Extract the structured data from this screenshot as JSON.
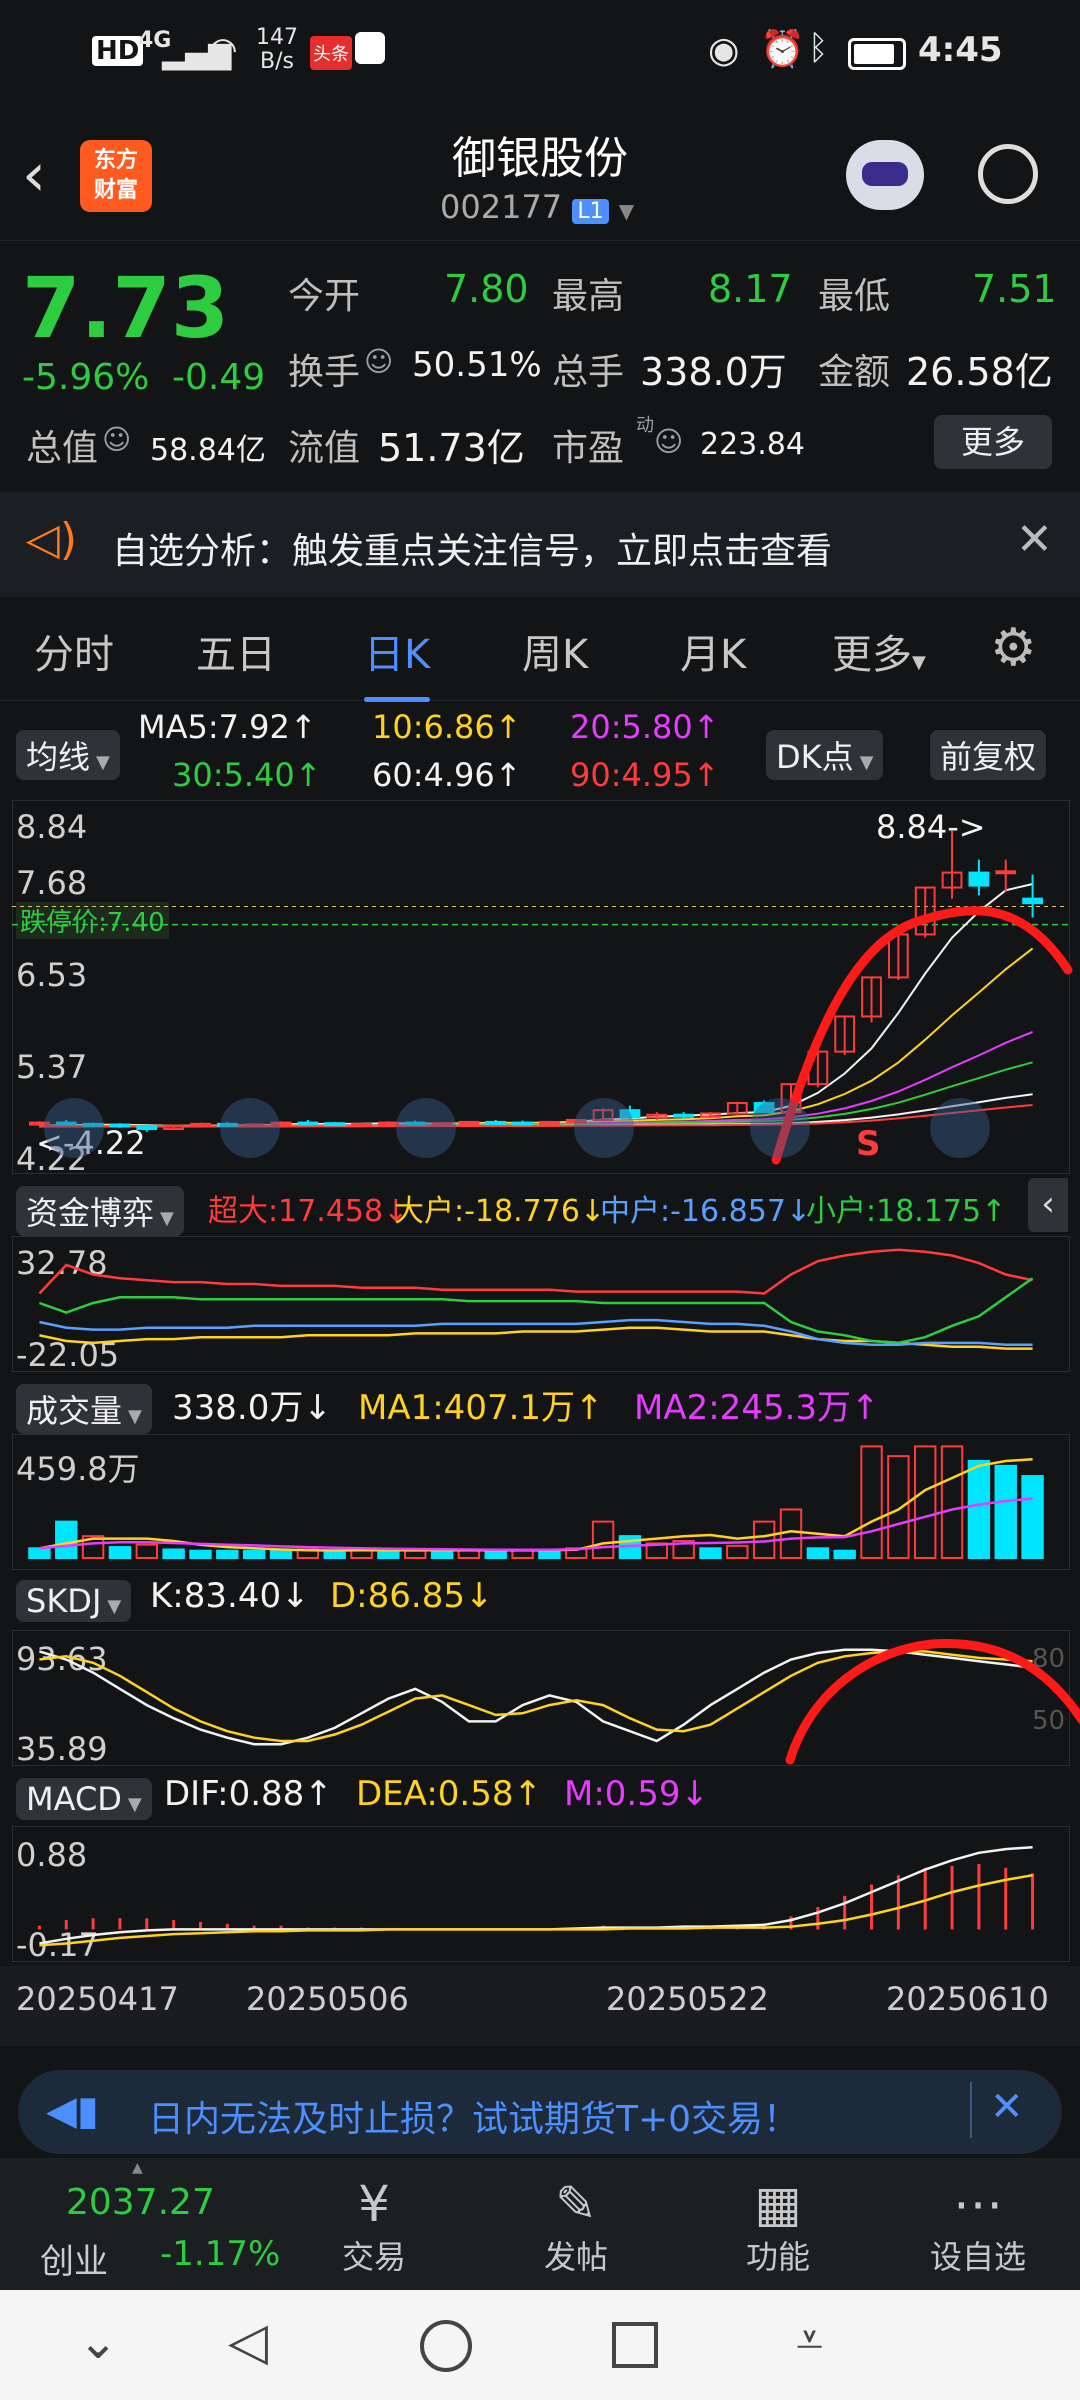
{
  "status_bar": {
    "time": "4:45",
    "network": "4G",
    "speed_value": "147",
    "speed_unit": "B/s",
    "badge": "头条"
  },
  "header": {
    "logo_line1": "东方",
    "logo_line2": "财富",
    "title": "御银股份",
    "code": "002177",
    "market_badge": "L1"
  },
  "quote": {
    "price": "7.73",
    "change_pct": "-5.96%",
    "change": "-0.49",
    "open_label": "今开",
    "open": "7.80",
    "high_label": "最高",
    "high": "8.17",
    "low_label": "最低",
    "low": "7.51",
    "turnover_rate_label": "换手",
    "turnover_rate": "50.51%",
    "volume_label": "总手",
    "volume": "338.0万",
    "amount_label": "金额",
    "amount": "26.58亿",
    "total_cap_label": "总值",
    "total_cap": "58.84亿",
    "float_cap_label": "流值",
    "float_cap": "51.73亿",
    "pe_label": "市盈",
    "pe_superscript": "动",
    "pe": "223.84",
    "more_button": "更多"
  },
  "notice": {
    "text": "自选分析：触发重点关注信号，立即点击查看"
  },
  "tabs": [
    {
      "label": "分时"
    },
    {
      "label": "五日"
    },
    {
      "label": "日K"
    },
    {
      "label": "周K"
    },
    {
      "label": "月K"
    },
    {
      "label": "更多"
    }
  ],
  "chart_data": [
    {
      "type": "candlestick",
      "name": "日K",
      "indicator_selector": "均线",
      "ma_labels": [
        "MA5:7.92↑",
        "10:6.86↑",
        "20:5.80↑",
        "30:5.40↑",
        "60:4.96↑",
        "90:4.95↑"
      ],
      "ma_colors": [
        "#f2f2f2",
        "#ffd21f",
        "#e63cff",
        "#2ecc40",
        "#f2f2f2",
        "#ff3b3b"
      ],
      "buttons": [
        "DK点",
        "前复权"
      ],
      "y_ticks": [
        "8.84",
        "7.68",
        "6.53",
        "5.37",
        "4.22"
      ],
      "ylim": [
        4.0,
        9.1
      ],
      "limit_down_label": "跌停价:7.40",
      "limit_down": 7.4,
      "high_label": "8.84->",
      "low_label": "<-4.22",
      "signal_label": "S",
      "candles": [
        [
          4.35,
          4.38,
          4.32,
          4.36
        ],
        [
          4.36,
          4.4,
          4.33,
          4.34
        ],
        [
          4.34,
          4.36,
          4.3,
          4.33
        ],
        [
          4.33,
          4.35,
          4.28,
          4.3
        ],
        [
          4.3,
          4.32,
          4.22,
          4.26
        ],
        [
          4.26,
          4.33,
          4.25,
          4.31
        ],
        [
          4.31,
          4.36,
          4.29,
          4.34
        ],
        [
          4.34,
          4.37,
          4.3,
          4.32
        ],
        [
          4.32,
          4.35,
          4.29,
          4.33
        ],
        [
          4.33,
          4.38,
          4.31,
          4.36
        ],
        [
          4.36,
          4.4,
          4.33,
          4.35
        ],
        [
          4.35,
          4.37,
          4.31,
          4.33
        ],
        [
          4.33,
          4.36,
          4.3,
          4.34
        ],
        [
          4.34,
          4.38,
          4.32,
          4.36
        ],
        [
          4.36,
          4.39,
          4.33,
          4.34
        ],
        [
          4.34,
          4.37,
          4.31,
          4.35
        ],
        [
          4.35,
          4.38,
          4.32,
          4.37
        ],
        [
          4.37,
          4.4,
          4.34,
          4.36
        ],
        [
          4.36,
          4.39,
          4.33,
          4.35
        ],
        [
          4.35,
          4.38,
          4.32,
          4.37
        ],
        [
          4.37,
          4.42,
          4.35,
          4.4
        ],
        [
          4.4,
          4.58,
          4.38,
          4.55
        ],
        [
          4.55,
          4.62,
          4.4,
          4.44
        ],
        [
          4.44,
          4.52,
          4.4,
          4.48
        ],
        [
          4.48,
          4.52,
          4.42,
          4.45
        ],
        [
          4.45,
          4.52,
          4.43,
          4.5
        ],
        [
          4.5,
          4.68,
          4.48,
          4.66
        ],
        [
          4.66,
          4.7,
          4.5,
          4.52
        ],
        [
          4.52,
          4.95,
          4.5,
          4.95
        ],
        [
          4.95,
          5.46,
          4.9,
          5.45
        ],
        [
          5.45,
          6.0,
          5.4,
          5.99
        ],
        [
          5.99,
          6.6,
          5.9,
          6.59
        ],
        [
          6.59,
          7.26,
          6.55,
          7.25
        ],
        [
          7.25,
          7.98,
          7.2,
          7.97
        ],
        [
          7.97,
          8.84,
          7.8,
          8.2
        ],
        [
          8.2,
          8.4,
          7.85,
          8.0
        ],
        [
          8.22,
          8.4,
          7.9,
          8.22
        ],
        [
          7.8,
          8.17,
          7.51,
          7.73
        ]
      ]
    },
    {
      "type": "line",
      "name": "资金博弈",
      "indicator_selector": "资金博弈",
      "labels": [
        "超大:17.458↓",
        "大户:-18.776↓",
        "中户:-16.857↓",
        "小户:18.175↑"
      ],
      "y_ticks": [
        "32.78",
        "-22.05"
      ],
      "ylim": [
        -25,
        35
      ],
      "series": [
        {
          "name": "超大",
          "color": "#ff3b3b",
          "values": [
            10,
            25,
            20,
            18,
            17,
            16,
            16,
            15,
            15,
            14,
            14,
            14,
            13,
            13,
            13,
            12,
            12,
            12,
            12,
            12,
            11,
            11,
            11,
            11,
            11,
            11,
            11,
            10,
            20,
            27,
            30,
            32,
            33,
            32,
            30,
            26,
            20,
            17
          ]
        },
        {
          "name": "大户",
          "color": "#ffd21f",
          "values": [
            -12,
            -15,
            -16,
            -15,
            -14,
            -14,
            -13,
            -13,
            -13,
            -13,
            -12,
            -12,
            -12,
            -12,
            -11,
            -11,
            -11,
            -11,
            -10,
            -10,
            -10,
            -9,
            -8,
            -8,
            -9,
            -10,
            -10,
            -10,
            -12,
            -14,
            -15,
            -15,
            -16,
            -17,
            -18,
            -18,
            -19,
            -19
          ]
        },
        {
          "name": "中户",
          "color": "#5aa0ff",
          "values": [
            -5,
            -8,
            -9,
            -9,
            -8,
            -8,
            -8,
            -8,
            -7,
            -7,
            -7,
            -7,
            -7,
            -7,
            -7,
            -6,
            -6,
            -6,
            -6,
            -6,
            -6,
            -5,
            -4,
            -4,
            -5,
            -6,
            -6,
            -7,
            -10,
            -14,
            -16,
            -17,
            -17,
            -16,
            -16,
            -16,
            -17,
            -17
          ]
        },
        {
          "name": "小户",
          "color": "#2ecc40",
          "values": [
            5,
            0,
            5,
            8,
            8,
            8,
            7,
            7,
            7,
            7,
            7,
            7,
            7,
            7,
            7,
            7,
            6,
            6,
            6,
            6,
            6,
            5,
            5,
            5,
            5,
            5,
            5,
            5,
            -5,
            -10,
            -12,
            -15,
            -16,
            -13,
            -7,
            -2,
            8,
            18
          ]
        }
      ]
    },
    {
      "type": "bar",
      "name": "成交量",
      "indicator_selector": "成交量",
      "labels": [
        "338.0万↓",
        "MA1:407.1万↑",
        "MA2:245.3万↑"
      ],
      "y_ticks": [
        "459.8万"
      ],
      "ylim": [
        0,
        470
      ],
      "values": [
        40,
        150,
        90,
        45,
        55,
        35,
        30,
        30,
        30,
        30,
        35,
        30,
        35,
        30,
        30,
        30,
        35,
        30,
        35,
        30,
        40,
        150,
        90,
        60,
        70,
        40,
        50,
        150,
        200,
        40,
        30,
        460,
        420,
        460,
        460,
        400,
        380,
        338
      ],
      "up": [
        0,
        0,
        1,
        0,
        1,
        0,
        0,
        0,
        0,
        0,
        1,
        0,
        1,
        0,
        1,
        0,
        1,
        0,
        1,
        0,
        1,
        1,
        0,
        1,
        1,
        0,
        1,
        1,
        1,
        0,
        0,
        1,
        1,
        1,
        1,
        0,
        0,
        0
      ],
      "ma_series": [
        {
          "name": "MA1",
          "color": "#ffd21f",
          "values": [
            40,
            60,
            80,
            80,
            80,
            70,
            55,
            45,
            40,
            35,
            32,
            31,
            32,
            32,
            32,
            32,
            32,
            32,
            32,
            32,
            34,
            60,
            70,
            80,
            90,
            95,
            80,
            90,
            110,
            100,
            90,
            150,
            200,
            280,
            330,
            380,
            400,
            407
          ]
        },
        {
          "name": "MA2",
          "color": "#e63cff",
          "values": [
            40,
            50,
            60,
            65,
            65,
            62,
            58,
            55,
            52,
            48,
            45,
            42,
            40,
            38,
            37,
            36,
            35,
            34,
            34,
            34,
            36,
            45,
            50,
            55,
            60,
            62,
            64,
            68,
            80,
            85,
            86,
            110,
            140,
            170,
            200,
            220,
            235,
            245
          ]
        }
      ]
    },
    {
      "type": "line",
      "name": "SKDJ",
      "indicator_selector": "SKDJ",
      "labels": [
        "K:83.40↓",
        "D:86.85↓"
      ],
      "y_ticks": [
        "93.63",
        "35.89",
        "80",
        "50"
      ],
      "ylim": [
        30,
        100
      ],
      "series": [
        {
          "name": "K",
          "color": "#f2f2f2",
          "values": [
            93,
            88,
            80,
            70,
            60,
            52,
            45,
            40,
            36,
            36,
            40,
            46,
            55,
            64,
            70,
            62,
            50,
            50,
            60,
            66,
            62,
            50,
            44,
            38,
            48,
            60,
            70,
            80,
            88,
            92,
            94,
            94,
            93,
            91,
            89,
            87,
            85,
            83
          ]
        },
        {
          "name": "D",
          "color": "#ffd21f",
          "values": [
            88,
            90,
            86,
            78,
            68,
            58,
            50,
            44,
            40,
            38,
            38,
            42,
            48,
            56,
            64,
            66,
            60,
            54,
            55,
            60,
            63,
            60,
            52,
            45,
            44,
            48,
            58,
            68,
            78,
            86,
            90,
            92,
            93,
            93,
            91,
            89,
            88,
            87
          ]
        }
      ]
    },
    {
      "type": "line",
      "name": "MACD",
      "indicator_selector": "MACD",
      "labels": [
        "DIF:0.88↑",
        "DEA:0.58↑",
        "M:0.59↓"
      ],
      "y_ticks": [
        "0.88",
        "-0.17"
      ],
      "ylim": [
        -0.22,
        1.0
      ],
      "series": [
        {
          "name": "DIF",
          "color": "#f2f2f2",
          "values": [
            -0.15,
            -0.1,
            -0.06,
            -0.03,
            -0.01,
            0.0,
            0.0,
            0.0,
            0.0,
            0.0,
            0.0,
            0.0,
            0.0,
            0.0,
            0.0,
            0.0,
            0.0,
            0.0,
            0.0,
            0.0,
            0.01,
            0.02,
            0.02,
            0.02,
            0.03,
            0.03,
            0.04,
            0.05,
            0.1,
            0.18,
            0.28,
            0.4,
            0.52,
            0.64,
            0.74,
            0.82,
            0.86,
            0.88
          ]
        },
        {
          "name": "DEA",
          "color": "#ffd21f",
          "values": [
            -0.17,
            -0.15,
            -0.12,
            -0.09,
            -0.07,
            -0.05,
            -0.04,
            -0.03,
            -0.02,
            -0.02,
            -0.01,
            -0.01,
            -0.01,
            0.0,
            0.0,
            0.0,
            0.0,
            0.0,
            0.0,
            0.0,
            0.0,
            0.0,
            0.01,
            0.01,
            0.01,
            0.02,
            0.02,
            0.02,
            0.03,
            0.06,
            0.1,
            0.16,
            0.23,
            0.31,
            0.4,
            0.47,
            0.53,
            0.58
          ]
        }
      ],
      "x_labels": [
        "20250417",
        "20250506",
        "20250522",
        "20250610"
      ]
    }
  ],
  "banner": {
    "text": "日内无法及时止损？试试期货T+0交易！"
  },
  "bottom_nav": {
    "index_value": "2037.27",
    "index_name": "创业",
    "index_change": "-1.17%",
    "items": [
      {
        "label": "交易"
      },
      {
        "label": "发帖"
      },
      {
        "label": "功能"
      },
      {
        "label": "设自选"
      }
    ]
  },
  "colors": {
    "up": "#ff3b3b",
    "down": "#00e5ff",
    "accent": "#4d8fff",
    "price_down": "#2ecc40"
  }
}
